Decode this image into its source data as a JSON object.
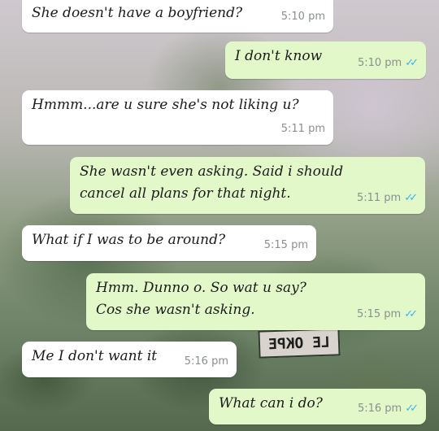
{
  "chat": {
    "messages": [
      {
        "text": "She doesn't have a boyfriend?",
        "time": "5:10 pm",
        "direction": "in"
      },
      {
        "text": "I don't know",
        "time": "5:10 pm",
        "direction": "out",
        "read": true
      },
      {
        "text": "Hmmm...are u sure she's not liking u?",
        "time": "5:11 pm",
        "direction": "in"
      },
      {
        "text": "She wasn't even asking. Said i should cancel all plans for that night.",
        "time": "5:11 pm",
        "direction": "out",
        "read": true
      },
      {
        "text": "What if I was to be around?",
        "time": "5:15 pm",
        "direction": "in"
      },
      {
        "text": "Hmm. Dunno o. So wat u say? Cos she wasn't asking.",
        "time": "5:15 pm",
        "direction": "out",
        "read": true
      },
      {
        "text": "Me I don't want it",
        "time": "5:16 pm",
        "direction": "in"
      },
      {
        "text": "What can i do?",
        "time": "5:16 pm",
        "direction": "out",
        "read": true
      }
    ]
  },
  "wallpaper": {
    "name_tag": "LE OKPE"
  },
  "colors": {
    "incoming": "#ffffff",
    "outgoing": "#e2f8c9",
    "read_ticks": "#34b7f1"
  },
  "icons": {
    "read_receipt": "double-check-icon"
  }
}
